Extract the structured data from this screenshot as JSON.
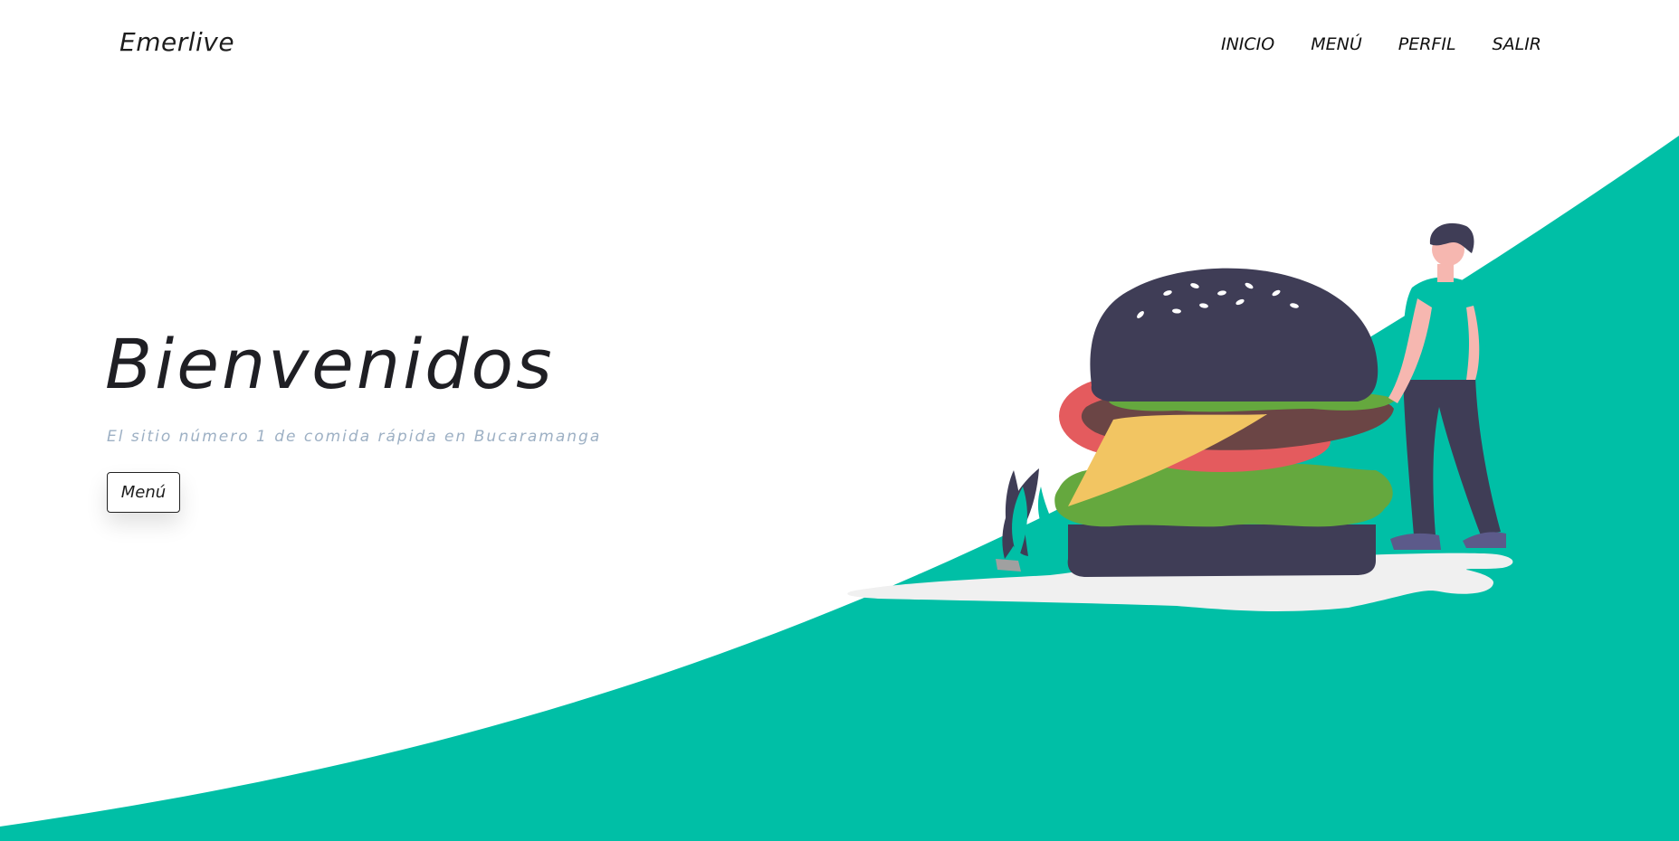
{
  "brand": "Emerlive",
  "nav": {
    "items": [
      "INICIO",
      "MENÚ",
      "PERFIL",
      "SALIR"
    ]
  },
  "hero": {
    "title": "Bienvenidos",
    "subtitle": "El sitio número 1 de comida rápida en Bucaramanga",
    "button_label": "Menú"
  },
  "colors": {
    "accent": "#00bfa6",
    "bun": "#3f3d56",
    "text_muted": "#9db0c4"
  },
  "illustration": "burger-with-person-illustration"
}
